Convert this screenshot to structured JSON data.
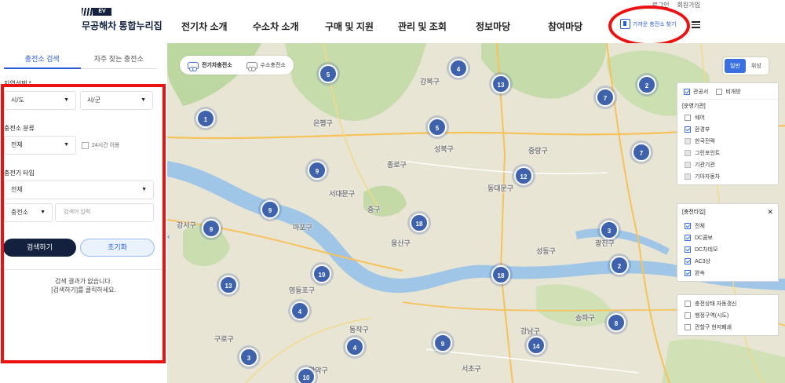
{
  "header": {
    "util": [
      "로그인",
      "회원가입"
    ],
    "logo_tag": "EV",
    "logo_name": "무공해차 통합누리집",
    "nav": [
      "전기차 소개",
      "수소차 소개",
      "구매 및 지원",
      "관리 및 조회",
      "정보마당",
      "참여마당"
    ],
    "quick_label": "가까운 충전소 찾기"
  },
  "panel": {
    "tabs": [
      "충전소 검색",
      "자주 찾는 충전소"
    ],
    "region_label": "지역선택 *",
    "sido": "시/도",
    "sigungu": "시/군",
    "type_label": "충전소 분류",
    "type_value": "전체",
    "open24": "24시간 이용",
    "charger_label": "충전기 타입",
    "charger_value": "전체",
    "search_field": "충전소",
    "search_placeholder": "검색어 입력",
    "search_btn": "검색하기",
    "reset_btn": "초기화",
    "empty_line1": "검색 결과가 없습니다.",
    "empty_line2": "[검색하기]를 클릭하세요."
  },
  "map": {
    "type_tabs": [
      "전기차충전소",
      "수소충전소"
    ],
    "mode": [
      "일반",
      "위성"
    ],
    "markers": [
      "5",
      "4",
      "13",
      "2",
      "7",
      "1",
      "5",
      "7",
      "9",
      "12",
      "9",
      "9",
      "18",
      "3",
      "2",
      "19",
      "18",
      "13",
      "4",
      "4",
      "9",
      "14",
      "8",
      "3",
      "10"
    ],
    "labels": [
      "강북구",
      "성북구",
      "중랑구",
      "은평구",
      "동대문구",
      "종로구",
      "서대문구",
      "마포구",
      "중구",
      "용산구",
      "성동구",
      "광진구",
      "강서구",
      "영등포구",
      "동작구",
      "강남구",
      "송파구",
      "서초구",
      "구로구",
      "관악구"
    ],
    "filter1": {
      "opts": [
        "관공서",
        "비개방"
      ],
      "title": "[운영기관]",
      "items": [
        {
          "label": "쉐어",
          "state": "off"
        },
        {
          "label": "환경부",
          "state": "on"
        },
        {
          "label": "한국전력",
          "state": "dis"
        },
        {
          "label": "그린포인트",
          "state": "dis"
        },
        {
          "label": "기관기관",
          "state": "dis"
        },
        {
          "label": "기아자동차",
          "state": "dis"
        }
      ]
    },
    "filter2": {
      "title": "[충전타입]",
      "items": [
        {
          "label": "전체",
          "state": "on"
        },
        {
          "label": "DC콤보",
          "state": "on"
        },
        {
          "label": "DC차데모",
          "state": "on"
        },
        {
          "label": "AC3상",
          "state": "on"
        },
        {
          "label": "완속",
          "state": "on"
        }
      ]
    },
    "filter3": {
      "items": [
        "충전상태 자동갱신",
        "행정구역(시도)",
        "관할구 현저폐쇄"
      ]
    }
  }
}
